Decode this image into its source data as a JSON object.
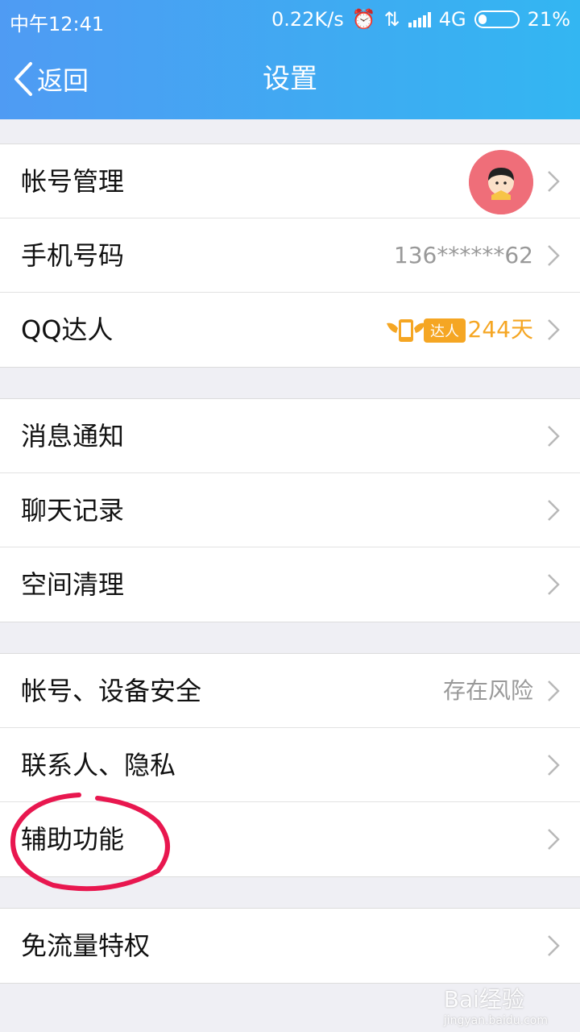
{
  "statusbar": {
    "time": "中午12:41",
    "speed": "0.22K/s",
    "network": "4G",
    "battery": "21%"
  },
  "header": {
    "back_label": "返回",
    "title": "设置"
  },
  "groups": [
    {
      "items": [
        {
          "label": "帐号管理",
          "value": ""
        },
        {
          "label": "手机号码",
          "value": "136******62"
        },
        {
          "label": "QQ达人",
          "badge": "达人",
          "value": "244天"
        }
      ]
    },
    {
      "items": [
        {
          "label": "消息通知",
          "value": ""
        },
        {
          "label": "聊天记录",
          "value": ""
        },
        {
          "label": "空间清理",
          "value": ""
        }
      ]
    },
    {
      "items": [
        {
          "label": "帐号、设备安全",
          "value": "存在风险"
        },
        {
          "label": "联系人、隐私",
          "value": ""
        },
        {
          "label": "辅助功能",
          "value": ""
        }
      ]
    },
    {
      "items": [
        {
          "label": "免流量特权",
          "value": ""
        }
      ]
    }
  ],
  "watermark": {
    "brand": "Bai经验",
    "url": "jingyan.baidu.com"
  },
  "colors": {
    "header_start": "#4f9bf3",
    "header_end": "#33b6f2",
    "gold": "#f5a623",
    "annotation": "#e8174f"
  }
}
